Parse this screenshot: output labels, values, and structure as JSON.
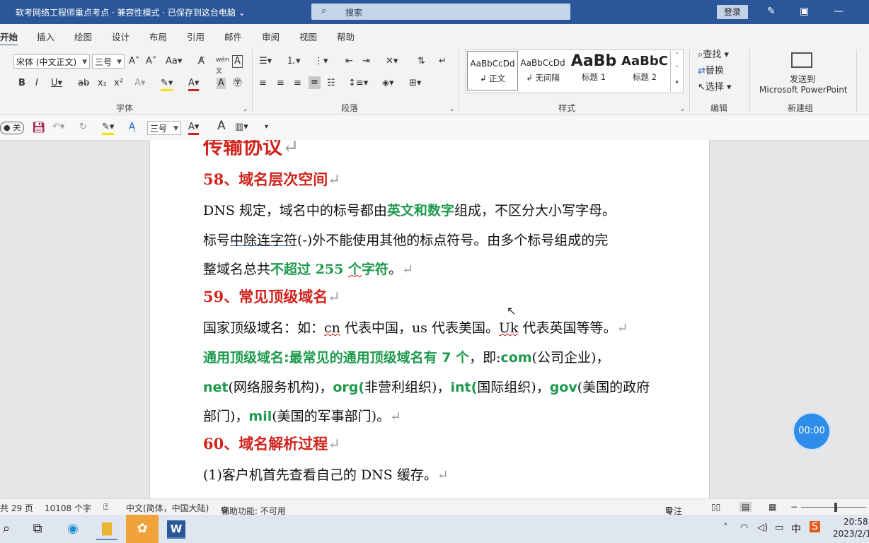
{
  "titlebar": {
    "title": "软考网络工程师重点考点 · 兼容性模式 · 已保存到这台电脑 ⌄",
    "search_placeholder": "搜索",
    "login": "登录"
  },
  "tabs": [
    "开始",
    "插入",
    "绘图",
    "设计",
    "布局",
    "引用",
    "邮件",
    "审阅",
    "视图",
    "帮助"
  ],
  "ribbon": {
    "font_name": "宋体 (中文正文)",
    "font_size": "三号",
    "group_font": "字体",
    "group_paragraph": "段落",
    "group_styles": "样式",
    "group_edit": "编辑",
    "group_new": "新建组",
    "styles": [
      {
        "preview": "AaBbCcDd",
        "label": "↲ 正文"
      },
      {
        "preview": "AaBbCcDd",
        "label": "↲ 无间隔"
      },
      {
        "preview": "AaBb",
        "label": "标题 1"
      },
      {
        "preview": "AaBbC",
        "label": "标题 2"
      }
    ],
    "find": "查找",
    "replace": "替换",
    "select": "选择",
    "send_to": "发送到",
    "ppt": "Microsoft PowerPoint"
  },
  "qat": {
    "font_size": "三号"
  },
  "doc": {
    "l0": "传输协议",
    "h58": "58、域名层次空间",
    "p1a": "DNS 规定，域名中的标号都由",
    "p1b": "英文和数字",
    "p1c": "组成，不区分大小写字母。",
    "p2a": "标号",
    "p2b": "中除连字符",
    "p2c": "(-)外不能使用其他的标点符号。由多个标号组成的完",
    "p3a": "整域名总共",
    "p3b": "不超过 255 ",
    "p3c": "个",
    "p3d": "字符",
    "p3e": "。",
    "h59": "59、常见顶级域名",
    "p4a": "国家顶级域名：如：",
    "p4b": "cn",
    "p4c": " 代表中国，us 代表美国。",
    "p4d": "Uk",
    "p4e": " 代表英国等等。",
    "p5a": "通用顶级域名:最常见的通用顶级域名有 7 个",
    "p5b": "，即:",
    "p5c": "com",
    "p5d": "(公司企业)，",
    "p6a": "net",
    "p6b": "(网络服务机构)，",
    "p6c": "org(",
    "p6d": "非营利组织)，",
    "p6e": "int(",
    "p6f": "国际组织)，",
    "p6g": "gov",
    "p6h": "(美国的政府",
    "p7a": "部门)，",
    "p7b": "mil",
    "p7c": "(美国的军事部门)。",
    "h60": "60、域名解析过程",
    "p8": "(1)客户机首先查看自己的 DNS 缓存。",
    "pm": "↵"
  },
  "timer": "00:00",
  "status": {
    "pages": "共 29 页",
    "words": "10108 个字",
    "lang": "中文(简体，中国大陆)",
    "access": "辅助功能: 不可用",
    "focus": "专注"
  },
  "tray": {
    "ime": "中",
    "time": "20:58",
    "date": "2023/2/1"
  }
}
